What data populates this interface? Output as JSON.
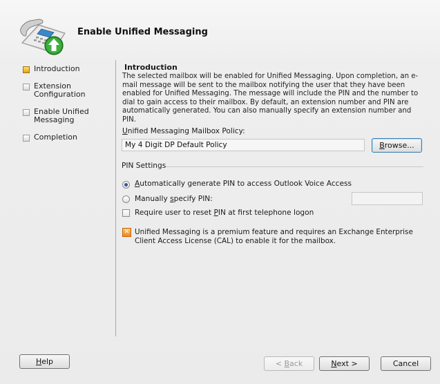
{
  "wizard": {
    "title": "Enable Unified Messaging"
  },
  "steps": [
    {
      "label": "Introduction",
      "current": true
    },
    {
      "label": "Extension Configuration",
      "current": false
    },
    {
      "label": "Enable Unified Messaging",
      "current": false
    },
    {
      "label": "Completion",
      "current": false
    }
  ],
  "intro": {
    "title": "Introduction",
    "description": "The selected mailbox will be enabled for Unified Messaging. Upon completion, an e-mail message will be sent to the mailbox notifying the user that they have been enabled for Unified Messaging. The message will include the PIN and the number to dial to gain access to their mailbox. By default, an extension number and PIN are automatically generated. You can also manually specify an extension number and PIN."
  },
  "policy": {
    "label_pre": "",
    "label_accel": "U",
    "label_post": "nified Messaging Mailbox Policy:",
    "value": "My 4 Digit DP Default Policy",
    "browse_accel": "B",
    "browse_post": "rowse..."
  },
  "pin_settings": {
    "group_label": "PIN Settings",
    "auto_pre": "",
    "auto_accel": "A",
    "auto_post": "utomatically generate PIN to access Outlook Voice Access",
    "auto_checked": true,
    "manual_pre": "Manually ",
    "manual_accel": "s",
    "manual_post": "pecify PIN:",
    "manual_checked": false,
    "manual_value": "",
    "reset_pre": "Require user to reset ",
    "reset_accel": "P",
    "reset_post": "IN at first telephone logon",
    "reset_checked": false
  },
  "notice": {
    "icon": "warning-icon",
    "text": "Unified Messaging is a premium feature and requires an Exchange Enterprise Client Access License (CAL) to enable it for the mailbox."
  },
  "footer": {
    "help_accel": "H",
    "help_post": "elp",
    "back_pre": "< ",
    "back_accel": "B",
    "back_post": "ack",
    "next_accel": "N",
    "next_post": "ext >",
    "cancel_label": "Cancel"
  },
  "colors": {
    "accent": "#3c7fb1",
    "current_step": "#e0a318",
    "notice": "#f08a1c",
    "header_arrow": "#2f9a2f"
  }
}
